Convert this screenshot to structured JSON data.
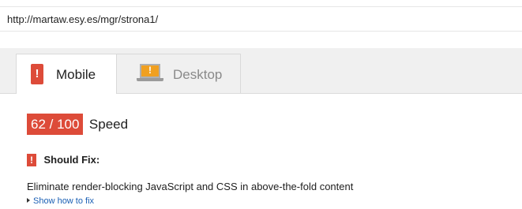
{
  "url": "http://martaw.esy.es/mgr/strona1/",
  "tabs": [
    {
      "label": "Mobile",
      "icon": "mobile-warning-icon",
      "selected": true
    },
    {
      "label": "Desktop",
      "icon": "desktop-warning-icon",
      "selected": false
    }
  ],
  "score": {
    "value": "62 / 100",
    "label": "Speed",
    "color": "#dd4b39"
  },
  "should_fix": {
    "icon_mark": "!",
    "title": "Should Fix:",
    "rule": "Eliminate render-blocking JavaScript and CSS in above-the-fold content",
    "link": "Show how to fix"
  },
  "colors": {
    "alert_red": "#dd4b39",
    "desktop_orange": "#f0a020",
    "link_blue": "#1a5fb4"
  }
}
